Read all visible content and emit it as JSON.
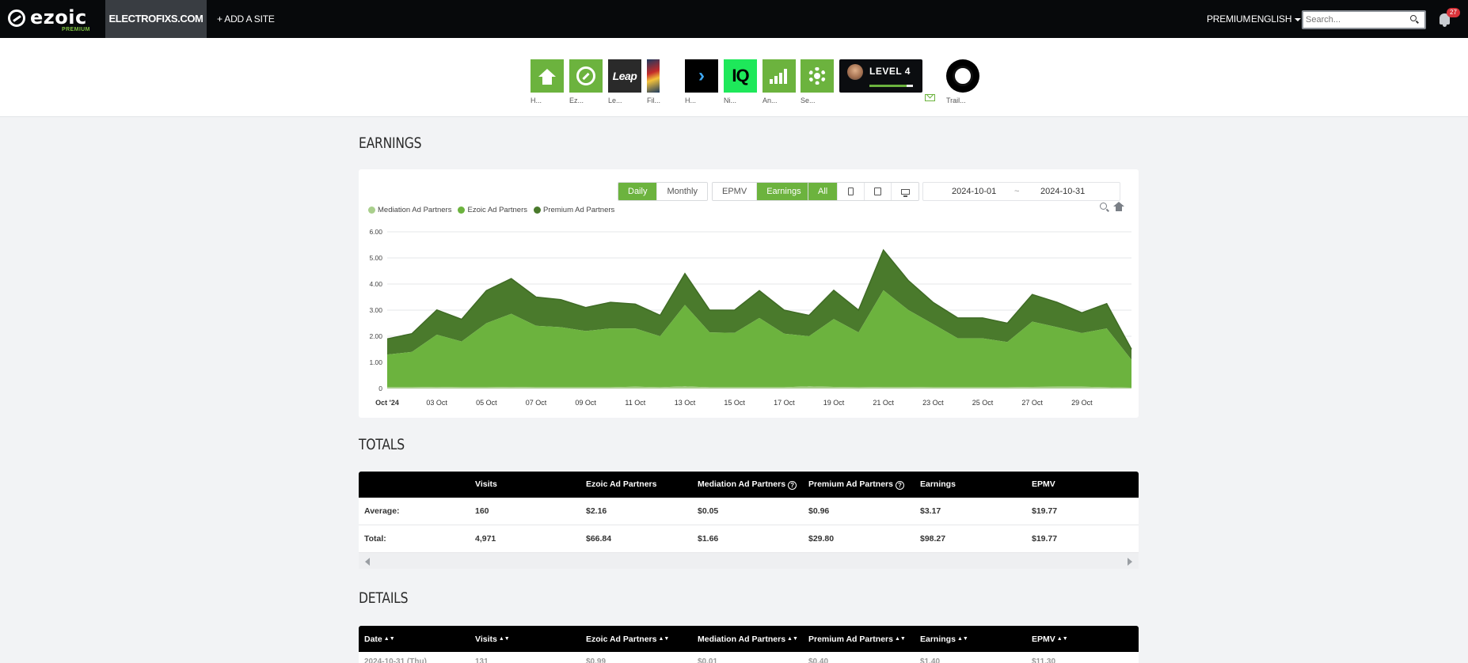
{
  "nav": {
    "logo_text": "ezoic",
    "logo_sub": "PREMIUM",
    "site": "ELECTROFIXS.COM",
    "add_site": "+ ADD A SITE",
    "premium": "PREMIUM",
    "language": "ENGLISH",
    "search_placeholder": "Search...",
    "notifications": "27"
  },
  "apps": [
    {
      "label": "H...",
      "icon": "home-icon"
    },
    {
      "label": "Ez...",
      "icon": "ezoic-icon"
    },
    {
      "label": "Le...",
      "icon": "leap-icon",
      "text": "Leap"
    },
    {
      "label": "Fil...",
      "icon": "flame-icon"
    },
    {
      "label": "H...",
      "icon": "chevron-right-icon",
      "text": "›"
    },
    {
      "label": "Ni...",
      "icon": "iq-icon",
      "text": "IQ"
    },
    {
      "label": "An...",
      "icon": "analytics-icon"
    },
    {
      "label": "Se...",
      "icon": "gear-icon"
    },
    {
      "label": "Trail...",
      "icon": "trail-icon"
    }
  ],
  "level": {
    "text": "LEVEL 4",
    "progress": 0.85
  },
  "earnings": {
    "title": "EARNINGS",
    "period_buttons": [
      "Daily",
      "Monthly"
    ],
    "period_active": "Daily",
    "metric_buttons": [
      "EPMV",
      "Earnings"
    ],
    "metric_active": "Earnings",
    "device_all": "All",
    "date_from": "2024-10-01",
    "date_sep": "~",
    "date_to": "2024-10-31"
  },
  "chart_data": {
    "type": "area",
    "stacked": true,
    "yticks": [
      "0",
      "1.00",
      "2.00",
      "3.00",
      "4.00",
      "5.00",
      "6.00"
    ],
    "ylim": [
      0,
      6
    ],
    "xlabels": [
      {
        "day": 1,
        "label": "Oct '24"
      },
      {
        "day": 3,
        "label": "03 Oct"
      },
      {
        "day": 5,
        "label": "05 Oct"
      },
      {
        "day": 7,
        "label": "07 Oct"
      },
      {
        "day": 9,
        "label": "09 Oct"
      },
      {
        "day": 11,
        "label": "11 Oct"
      },
      {
        "day": 13,
        "label": "13 Oct"
      },
      {
        "day": 15,
        "label": "15 Oct"
      },
      {
        "day": 17,
        "label": "17 Oct"
      },
      {
        "day": 19,
        "label": "19 Oct"
      },
      {
        "day": 21,
        "label": "21 Oct"
      },
      {
        "day": 23,
        "label": "23 Oct"
      },
      {
        "day": 25,
        "label": "25 Oct"
      },
      {
        "day": 27,
        "label": "27 Oct"
      },
      {
        "day": 29,
        "label": "29 Oct"
      }
    ],
    "days": [
      1,
      2,
      3,
      4,
      5,
      6,
      7,
      8,
      9,
      10,
      11,
      12,
      13,
      14,
      15,
      16,
      17,
      18,
      19,
      20,
      21,
      22,
      23,
      24,
      25,
      26,
      27,
      28,
      29,
      30,
      31
    ],
    "series": [
      {
        "name": "Mediation Ad Partners",
        "color": "#a9cf8c",
        "values": [
          0.05,
          0.05,
          0.06,
          0.05,
          0.05,
          0.06,
          0.05,
          0.05,
          0.05,
          0.05,
          0.07,
          0.05,
          0.08,
          0.05,
          0.05,
          0.05,
          0.05,
          0.08,
          0.06,
          0.05,
          0.06,
          0.06,
          0.05,
          0.05,
          0.05,
          0.05,
          0.06,
          0.07,
          0.07,
          0.05,
          0.03
        ]
      },
      {
        "name": "Ezoic Ad Partners",
        "color": "#6cb33e",
        "values": [
          1.25,
          1.35,
          2.0,
          1.75,
          2.45,
          2.8,
          2.35,
          2.3,
          2.15,
          2.25,
          2.23,
          1.95,
          3.12,
          2.1,
          2.08,
          2.65,
          2.05,
          1.92,
          2.6,
          2.1,
          3.7,
          2.95,
          2.42,
          1.87,
          1.87,
          1.73,
          2.5,
          2.28,
          2.05,
          2.25,
          1.07
        ]
      },
      {
        "name": "Premium Ad Partners",
        "color": "#4a7a2c",
        "values": [
          0.6,
          0.7,
          0.95,
          0.85,
          1.25,
          1.35,
          1.1,
          1.05,
          0.9,
          1.0,
          0.93,
          0.8,
          1.2,
          0.85,
          0.87,
          1.05,
          0.9,
          0.8,
          1.1,
          0.85,
          1.54,
          1.13,
          0.83,
          0.78,
          0.78,
          0.72,
          1.04,
          0.95,
          0.78,
          0.95,
          0.4
        ]
      }
    ]
  },
  "totals": {
    "title": "TOTALS",
    "headers": [
      "",
      "Visits",
      "Ezoic Ad Partners",
      "Mediation Ad Partners",
      "Premium Ad Partners",
      "Earnings",
      "EPMV"
    ],
    "rows": [
      [
        "Average:",
        "160",
        "$2.16",
        "$0.05",
        "$0.96",
        "$3.17",
        "$19.77"
      ],
      [
        "Total:",
        "4,971",
        "$66.84",
        "$1.66",
        "$29.80",
        "$98.27",
        "$19.77"
      ]
    ]
  },
  "details": {
    "title": "DETAILS",
    "headers": [
      "Date",
      "Visits",
      "Ezoic Ad Partners",
      "Mediation Ad Partners",
      "Premium Ad Partners",
      "Earnings",
      "EPMV"
    ],
    "first_row": [
      "2024-10-31 (Thu)",
      "131",
      "$0.99",
      "$0.01",
      "$0.40",
      "$1.40",
      "$11.30"
    ]
  }
}
